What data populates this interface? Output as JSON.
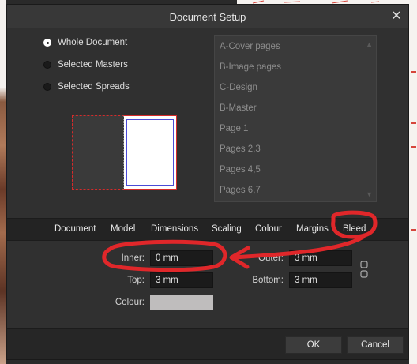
{
  "dialog": {
    "title": "Document Setup"
  },
  "range_options": [
    {
      "label": "Whole Document",
      "selected": true
    },
    {
      "label": "Selected Masters",
      "selected": false
    },
    {
      "label": "Selected Spreads",
      "selected": false
    }
  ],
  "pages_list": [
    "A-Cover pages",
    "B-Image pages",
    "C-Design",
    "B-Master",
    "Page 1",
    "Pages 2,3",
    "Pages 4,5",
    "Pages 6,7"
  ],
  "tabs": [
    "Document",
    "Model",
    "Dimensions",
    "Scaling",
    "Colour",
    "Margins",
    "Bleed"
  ],
  "active_tab": "Bleed",
  "bleed": {
    "inner_label": "Inner:",
    "inner_value": "0 mm",
    "outer_label": "Outer:",
    "outer_value": "3 mm",
    "top_label": "Top:",
    "top_value": "3 mm",
    "bottom_label": "Bottom:",
    "bottom_value": "3 mm",
    "colour_label": "Colour:",
    "colour_value": "#bfbdbd"
  },
  "buttons": {
    "ok": "OK",
    "cancel": "Cancel"
  },
  "colors": {
    "annotation_red": "#e0272a",
    "bleed_line": "#d62a2a",
    "margin_line": "#4b4bd6"
  },
  "icons": [
    "close-icon",
    "link-chain-icon",
    "scroll-up-icon",
    "scroll-down-icon"
  ]
}
